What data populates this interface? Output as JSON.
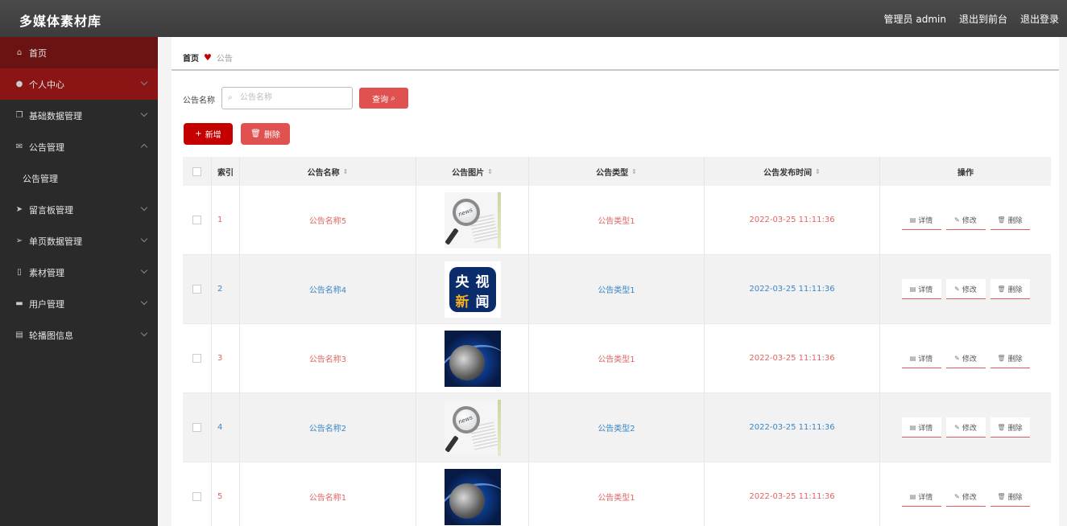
{
  "app": {
    "title": "多媒体素材库"
  },
  "header": {
    "admin_label": "管理员 admin",
    "exit_front": "退出到前台",
    "logout": "退出登录"
  },
  "sidebar": {
    "items": [
      {
        "label": "首页",
        "icon": "home-icon"
      },
      {
        "label": "个人中心",
        "icon": "user-icon"
      },
      {
        "label": "基础数据管理",
        "icon": "copy-icon"
      },
      {
        "label": "公告管理",
        "icon": "mail-icon"
      },
      {
        "label": "公告管理",
        "icon": ""
      },
      {
        "label": "留言板管理",
        "icon": "send-icon"
      },
      {
        "label": "单页数据管理",
        "icon": "send-icon"
      },
      {
        "label": "素材管理",
        "icon": "mic-icon"
      },
      {
        "label": "用户管理",
        "icon": "briefcase-icon"
      },
      {
        "label": "轮播图信息",
        "icon": "clipboard-icon"
      }
    ]
  },
  "breadcrumb": {
    "home": "首页",
    "current": "公告"
  },
  "search": {
    "label": "公告名称",
    "placeholder": "公告名称",
    "button": "查询"
  },
  "actions": {
    "add": "新增",
    "delete": "删除"
  },
  "table": {
    "headers": {
      "index": "索引",
      "name": "公告名称",
      "image": "公告图片",
      "type": "公告类型",
      "time": "公告发布时间",
      "ops": "操作"
    },
    "op_labels": {
      "detail": "详情",
      "edit": "修改",
      "delete": "删除"
    },
    "rows": [
      {
        "index": "1",
        "name": "公告名称5",
        "image": "news-magnifier",
        "type": "公告类型1",
        "time": "2022-03-25 11:11:36",
        "color": "#e06464"
      },
      {
        "index": "2",
        "name": "公告名称4",
        "image": "cctv-news-logo",
        "type": "公告类型1",
        "time": "2022-03-25 11:11:36",
        "color": "#3a86c8"
      },
      {
        "index": "3",
        "name": "公告名称3",
        "image": "blue-globe",
        "type": "公告类型1",
        "time": "2022-03-25 11:11:36",
        "color": "#e06464"
      },
      {
        "index": "4",
        "name": "公告名称2",
        "image": "news-magnifier",
        "type": "公告类型2",
        "time": "2022-03-25 11:11:36",
        "color": "#3a86c8"
      },
      {
        "index": "5",
        "name": "公告名称1",
        "image": "blue-globe",
        "type": "公告类型1",
        "time": "2022-03-25 11:11:36",
        "color": "#e06464"
      }
    ]
  },
  "thumb_text": {
    "news": "news",
    "cctv": [
      "央",
      "视",
      "新",
      "闻"
    ]
  },
  "colors": {
    "topbar": "#3c3c3c",
    "sidebar": "#2a2a2a",
    "accent": "#c40000",
    "active": "#8b1414",
    "link_red": "#e06464",
    "link_blue": "#3a86c8"
  }
}
